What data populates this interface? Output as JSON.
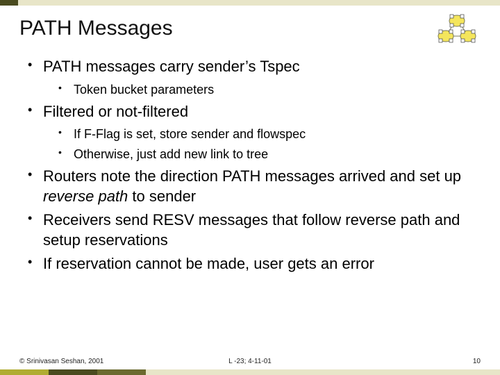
{
  "title": "PATH Messages",
  "bullets": {
    "b1": "PATH messages carry sender’s Tspec",
    "b1a": "Token bucket parameters",
    "b2": "Filtered or not-filtered",
    "b2a": "If F-Flag is set, store sender and flowspec",
    "b2b": "Otherwise, just add new link to tree",
    "b3_pre": "Routers note the direction PATH messages arrived and set up ",
    "b3_em": "reverse path",
    "b3_post": " to sender",
    "b4": "Receivers send RESV messages that follow reverse path and setup reservations",
    "b5": "If reservation cannot be made, user gets an error"
  },
  "footer": {
    "left": "© Srinivasan Seshan, 2001",
    "center": "L -23; 4-11-01",
    "right": "10"
  }
}
